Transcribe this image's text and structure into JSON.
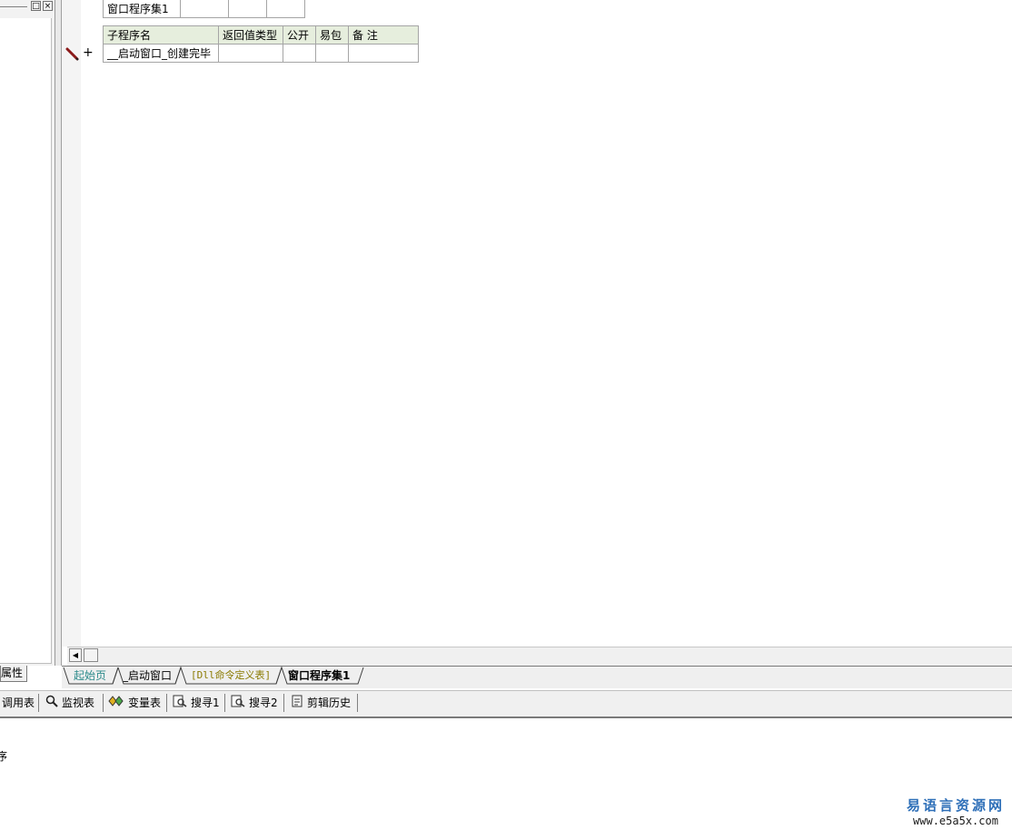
{
  "left_panel": {
    "restore_label": "□",
    "close_label": "×",
    "tab_label": "属性"
  },
  "program_set_table": {
    "name": "窗口程序集1",
    "cells": [
      "",
      "",
      ""
    ]
  },
  "subroutine_table": {
    "headers": [
      "子程序名",
      "返回值类型",
      "公开",
      "易包",
      "备 注"
    ],
    "row": [
      "__启动窗口_创建完毕",
      "",
      "",
      "",
      ""
    ]
  },
  "gutter": {
    "expand_label": "+"
  },
  "scrollbar": {
    "left_arrow": "◀"
  },
  "tabs": [
    {
      "label": "起始页",
      "color": "#2b8a8a"
    },
    {
      "label": "_启动窗口",
      "color": "#000000"
    },
    {
      "label": "[Dll命令定义表]",
      "color": "#8a7a00"
    },
    {
      "label": "窗口程序集1",
      "color": "#000000"
    }
  ],
  "toolbar": {
    "items": [
      {
        "label": "调用表",
        "icon": "call-table-icon"
      },
      {
        "label": "监视表",
        "icon": "magnifier-icon"
      },
      {
        "label": "变量表",
        "icon": "variables-icon"
      },
      {
        "label": "搜寻1",
        "icon": "search-doc-icon"
      },
      {
        "label": "搜寻2",
        "icon": "search-doc-icon"
      },
      {
        "label": "剪辑历史",
        "icon": "clipboard-icon"
      }
    ]
  },
  "output": {
    "text": "序"
  },
  "brand": {
    "name": "易语言资源网",
    "url": "www.e5a5x.com"
  }
}
